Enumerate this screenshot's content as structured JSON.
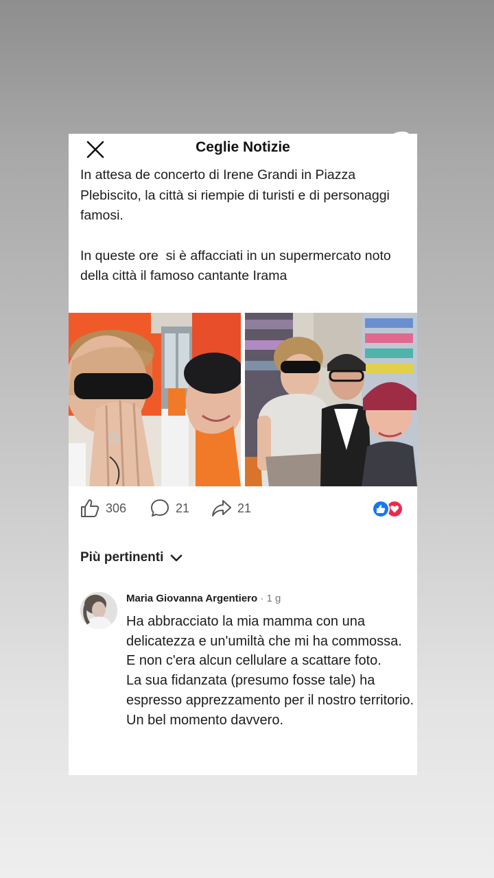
{
  "header": {
    "title": "Ceglie Notizie",
    "close_icon": "close-icon"
  },
  "post": {
    "paragraphs": [
      "In attesa de concerto di Irene Grandi in Piazza Plebiscito, la città si riempie di turisti e di personaggi famosi.",
      "In queste ore  si è affacciati in un supermercato noto della città il famoso cantante Irama"
    ],
    "photos": [
      "photo-selfie-in-shop",
      "photo-group-in-supermarket"
    ]
  },
  "actions": {
    "likes": "306",
    "comments": "21",
    "shares": "21",
    "reaction_icons": [
      "like-reaction-icon",
      "love-reaction-icon"
    ],
    "colors": {
      "like": "#1877f2",
      "love": "#f0284a"
    }
  },
  "comments_section": {
    "sort_label": "Più pertinenti",
    "sort_icon": "chevron-down-icon",
    "items": [
      {
        "author": "Maria Giovanna Argentiero",
        "time": " · 1 g",
        "text": "Ha abbracciato la mia mamma con una delicatezza e un'umiltà che mi ha commossa. E non c'era alcun cellulare a scattare foto.\nLa sua fidanzata (presumo fosse tale) ha espresso apprezzamento per il nostro territorio.\nUn bel momento davvero."
      }
    ]
  }
}
